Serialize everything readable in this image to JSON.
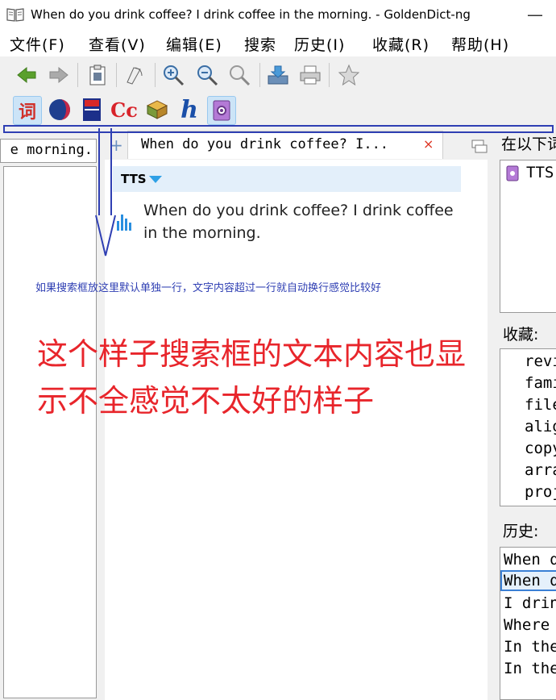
{
  "window": {
    "title": "When do you drink coffee? I drink coffee in the morning. - GoldenDict-ng",
    "minimize": "—"
  },
  "menu": [
    "文件(F)",
    "查看(V)",
    "编辑(E)",
    "搜索",
    "历史(I)",
    "收藏(R)",
    "帮助(H)"
  ],
  "toolbar": [
    "back-icon",
    "forward-icon",
    "clipboard-icon",
    "pronounce-icon",
    "zoom-in-icon",
    "zoom-out-icon",
    "zoom-reset-icon",
    "save-icon",
    "print-icon",
    "favorite-star-icon"
  ],
  "dictionaries": {
    "dict1": "词",
    "dict4": "Cc",
    "dict6": "h"
  },
  "left_search": {
    "value": "e morning."
  },
  "tab": {
    "label": "When do you drink coffee? I...",
    "close": "×",
    "add": "+"
  },
  "article": {
    "section": "TTS",
    "text": "When do you drink coffee? I drink coffee in the morning."
  },
  "annotations": {
    "small": "如果搜索框放这里默认单独一行，文字内容超过一行就自动换行感觉比较好",
    "big": "这个样子搜索框的文本内容也显示不全感觉不太好的样子"
  },
  "right": {
    "header": "在以下词",
    "dict_item": "TTS",
    "favorites_label": "收藏:",
    "favorites": [
      "revi",
      "fami",
      "file",
      "alig",
      "copy",
      "arra",
      "proj"
    ],
    "history_label": "历史:",
    "history": [
      "When d",
      "When d",
      "I drin",
      "Where ",
      "In the",
      "In the"
    ]
  },
  "colors": {
    "annotation_blue": "#2f3fb3",
    "annotation_red": "#e8252b",
    "selection": "#3a7fd5"
  }
}
